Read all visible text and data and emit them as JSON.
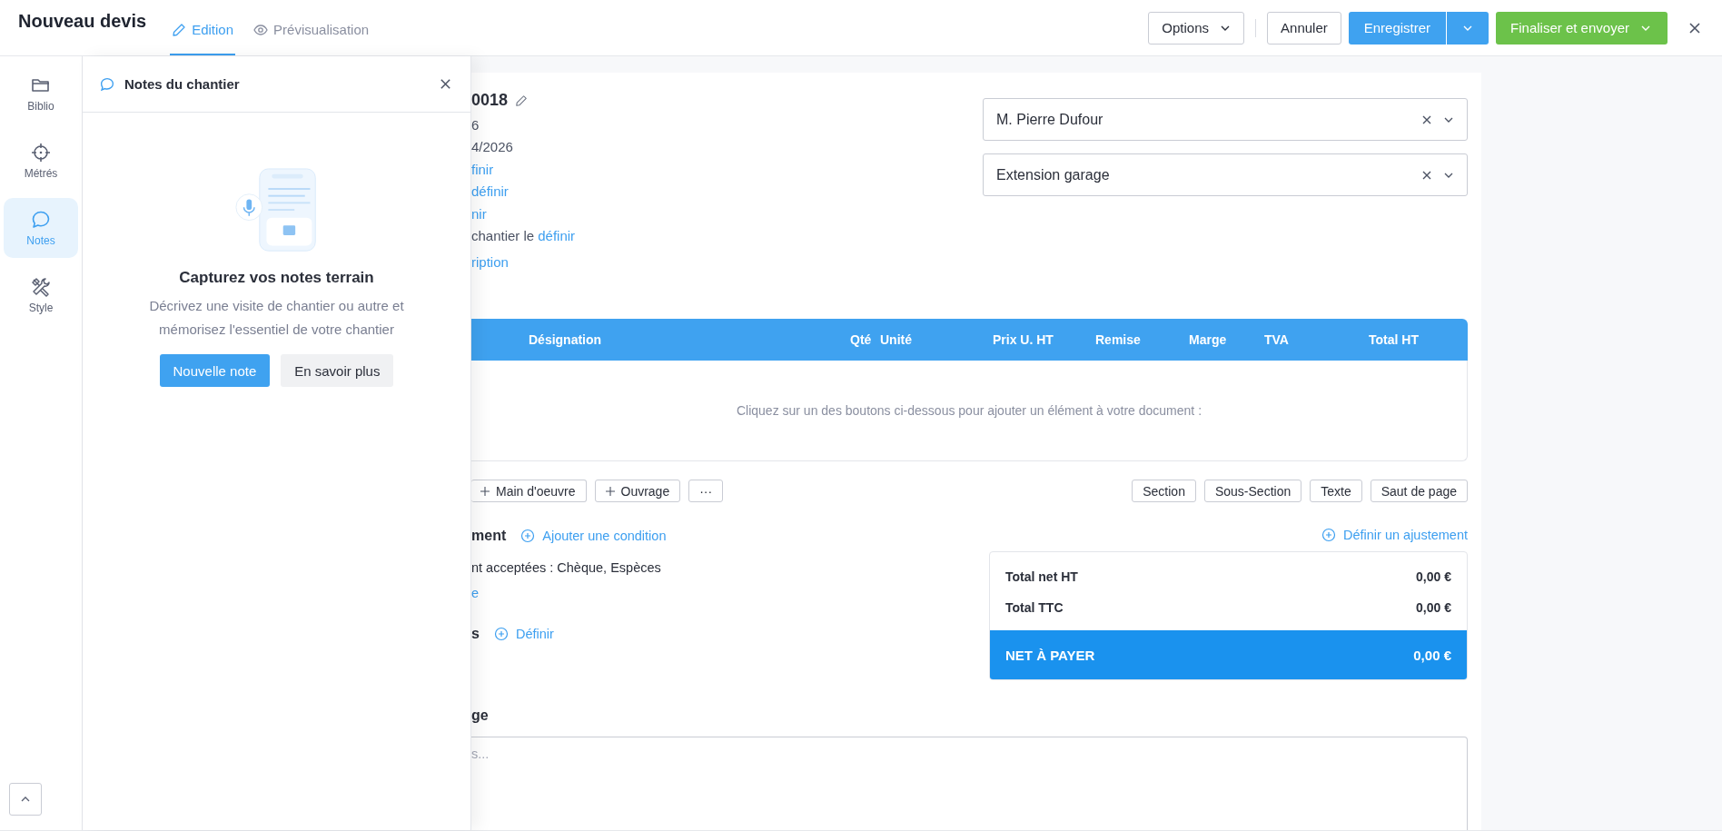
{
  "header": {
    "title": "Nouveau devis",
    "tabs": [
      {
        "label": "Edition",
        "selected": true
      },
      {
        "label": "Prévisualisation",
        "selected": false
      }
    ],
    "actions": {
      "options": "Options",
      "cancel": "Annuler",
      "save": "Enregistrer",
      "finalize": "Finaliser et envoyer"
    }
  },
  "sidebar": {
    "items": [
      {
        "label": "Biblio",
        "selected": false
      },
      {
        "label": "Métrés",
        "selected": false
      },
      {
        "label": "Notes",
        "selected": true
      },
      {
        "label": "Style",
        "selected": false
      }
    ]
  },
  "notes_panel": {
    "title": "Notes du chantier",
    "heading": "Capturez vos notes terrain",
    "description": "Décrivez une visite de chantier ou autre et mémorisez l'essentiel de votre chantier",
    "buttons": [
      {
        "label": "Nouvelle note",
        "kind": "primary"
      },
      {
        "label": "En savoir plus",
        "kind": "secondary"
      }
    ]
  },
  "document": {
    "number": "0018",
    "details": [
      {
        "kind": "text",
        "text": "6"
      },
      {
        "kind": "text",
        "text": "4/2026"
      },
      {
        "kind": "link",
        "text": "finir"
      },
      {
        "kind": "link",
        "text": "définir"
      },
      {
        "kind": "link",
        "text": "nir"
      },
      {
        "kind": "text_link",
        "text": "chantier le",
        "link": "définir"
      }
    ],
    "description_link": "ription",
    "client": "M. Pierre Dufour",
    "project": "Extension garage",
    "table": {
      "columns": [
        "Désignation",
        "Qté",
        "Unité",
        "Prix U. HT",
        "Remise",
        "Marge",
        "TVA",
        "Total HT"
      ],
      "empty_message": "Cliquez sur un des boutons ci-dessous pour ajouter un élément à votre document :"
    },
    "add_buttons": [
      {
        "label": "Main d'oeuvre",
        "kind": "plus"
      },
      {
        "label": "Ouvrage",
        "kind": "plus"
      },
      {
        "label": "···",
        "kind": "more"
      }
    ],
    "insert_buttons": [
      "Section",
      "Sous-Section",
      "Texte",
      "Saut de page"
    ],
    "payment": {
      "heading": "ment",
      "add_link": "Ajouter une condition",
      "text": "nt acceptées : Chèque, Espèces",
      "link": "e"
    },
    "other": {
      "heading": "s",
      "link": "Définir"
    },
    "adjust_link": "Définir un ajustement",
    "totals": {
      "rows": [
        {
          "label": "Total net HT",
          "value": "0,00 €"
        },
        {
          "label": "Total TTC",
          "value": "0,00 €"
        }
      ],
      "net": {
        "label": "NET À PAYER",
        "value": "0,00 €"
      }
    },
    "message": {
      "heading": "ge",
      "placeholder": "s..."
    }
  }
}
